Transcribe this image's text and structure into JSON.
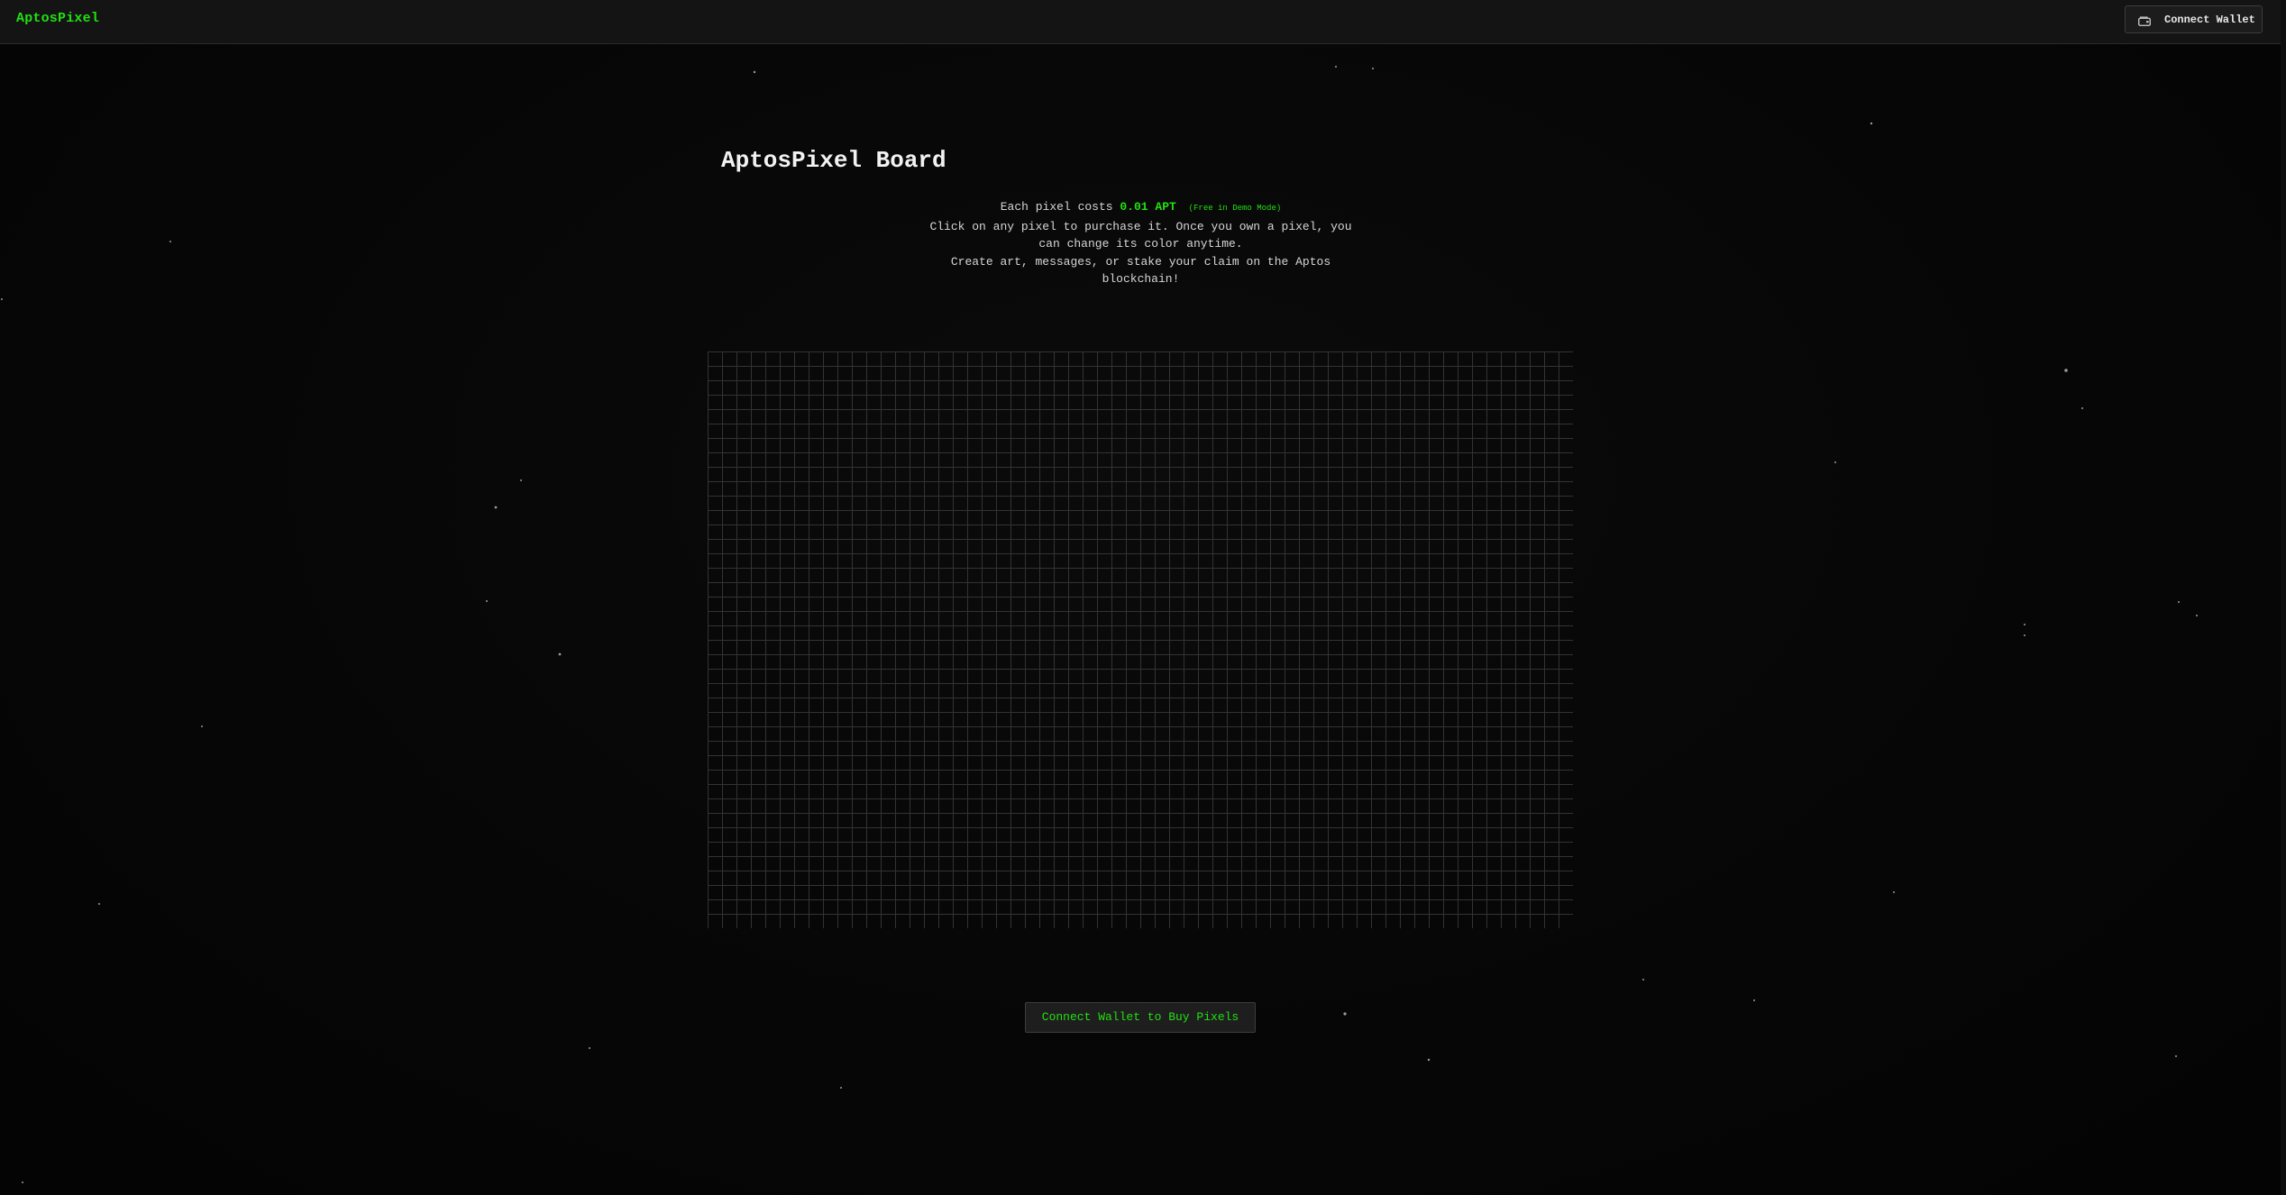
{
  "header": {
    "brand": "AptosPixel",
    "connect_wallet_label": "Connect Wallet",
    "wallet_icon": "wallet-icon"
  },
  "board": {
    "title": "AptosPixel Board",
    "price_prefix": "Each pixel costs",
    "price_value": "0.01 APT",
    "demo_note": "(Free in Demo Mode)",
    "line2": "Click on any pixel to purchase it. Once you own a pixel, you can change its color anytime.",
    "line3": "Create art, messages, or stake your claim on the Aptos blockchain!"
  },
  "grid": {
    "columns": 60,
    "rows": 40
  },
  "actions": {
    "buy_label": "Connect Wallet to Buy Pixels"
  },
  "colors": {
    "accent": "#22e012",
    "background": "#050505",
    "grid_line": "#333333"
  }
}
